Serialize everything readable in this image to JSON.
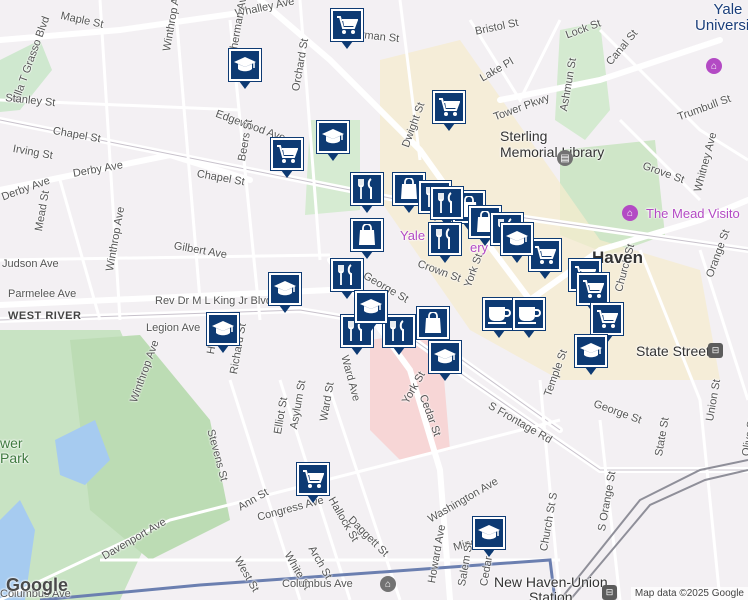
{
  "map": {
    "attribution": "Map data ©2025 Google",
    "logo": "Google",
    "pois": {
      "yale_university": "Yale\nUniversity",
      "sterling": "Sterling\nMemorial Library",
      "mead": "The Mead Visito",
      "yale_gallery": "Yale",
      "yale_gallery_suffix": "ery",
      "haven": "Haven",
      "state_street": "State Street",
      "union_station": "New Haven-Union\nStation",
      "west_river": "WEST RIVER",
      "park": "wer\nPark"
    },
    "streets": [
      "Maple St",
      "Whalley Ave",
      "Sherman Ave",
      "Winthrop Ave",
      "Orchard St",
      "Sherman St",
      "Bristol St",
      "Lock St",
      "Canal St",
      "Ella T Grasso Blvd",
      "Stanley St",
      "Lake Pl",
      "Ashmun St",
      "Trumbull St",
      "Tower Pkwy",
      "Edgewood Ave",
      "Dwight St",
      "Chapel St",
      "Irving St",
      "Beers St",
      "Grove St",
      "Whitney Ave",
      "Derby Ave",
      "Derby Ave",
      "Chapel St",
      "Mead St",
      "Winthrop Ave",
      "Gilbert Ave",
      "Orange St",
      "Judson Ave",
      "Crown St",
      "York St",
      "Parmelee Ave",
      "Rev Dr M L King Jr Blvd",
      "George St",
      "Church St",
      "Legion Ave",
      "Temple St",
      "Winthrop Ave",
      "Richard St",
      "Howe St",
      "Asylum St",
      "Ward St",
      "Ward Ave",
      "York St",
      "Cedar St",
      "George St",
      "Union St",
      "Elliot St",
      "Stevens St",
      "S Frontage Rd",
      "State St",
      "Olive St",
      "Ann St",
      "Congress Ave",
      "Hallock St",
      "Washington Ave",
      "Church St S",
      "S Orange St",
      "Davenport Ave",
      "West St",
      "White St",
      "Arch St",
      "Daggett St",
      "Minor St",
      "Columbus Ave",
      "Columbus Ave",
      "Howard Ave",
      "Salem St",
      "Cedar St"
    ]
  },
  "markers": [
    {
      "type": "cart",
      "icon": "shopping-cart-icon"
    },
    {
      "type": "school",
      "icon": "graduation-cap-icon"
    },
    {
      "type": "cart",
      "icon": "shopping-cart-icon"
    },
    {
      "type": "school",
      "icon": "graduation-cap-icon"
    },
    {
      "type": "cart",
      "icon": "shopping-cart-icon"
    },
    {
      "type": "food",
      "icon": "fork-knife-icon"
    },
    {
      "type": "shop",
      "icon": "shopping-bag-icon"
    },
    {
      "type": "food",
      "icon": "fork-knife-icon"
    },
    {
      "type": "shop",
      "icon": "shopping-bag-icon"
    },
    {
      "type": "food",
      "icon": "fork-knife-icon"
    },
    {
      "type": "shop",
      "icon": "shopping-bag-icon"
    },
    {
      "type": "food",
      "icon": "fork-knife-icon"
    },
    {
      "type": "shop",
      "icon": "shopping-bag-icon"
    },
    {
      "type": "cart",
      "icon": "shopping-cart-icon"
    },
    {
      "type": "food",
      "icon": "fork-knife-icon"
    },
    {
      "type": "school",
      "icon": "graduation-cap-icon"
    },
    {
      "type": "food",
      "icon": "fork-knife-icon"
    },
    {
      "type": "food",
      "icon": "fork-knife-icon"
    },
    {
      "type": "food",
      "icon": "fork-knife-icon"
    },
    {
      "type": "shop",
      "icon": "shopping-bag-icon"
    },
    {
      "type": "school",
      "icon": "graduation-cap-icon"
    },
    {
      "type": "school",
      "icon": "graduation-cap-icon"
    },
    {
      "type": "cafe",
      "icon": "coffee-cup-icon"
    },
    {
      "type": "cafe",
      "icon": "coffee-cup-icon"
    },
    {
      "type": "cart",
      "icon": "shopping-cart-icon"
    },
    {
      "type": "cart",
      "icon": "shopping-cart-icon"
    },
    {
      "type": "cart",
      "icon": "shopping-cart-icon"
    },
    {
      "type": "school",
      "icon": "graduation-cap-icon"
    },
    {
      "type": "school",
      "icon": "graduation-cap-icon"
    },
    {
      "type": "cart",
      "icon": "shopping-cart-icon"
    },
    {
      "type": "school",
      "icon": "graduation-cap-icon"
    },
    {
      "type": "school",
      "icon": "graduation-cap-icon"
    }
  ]
}
